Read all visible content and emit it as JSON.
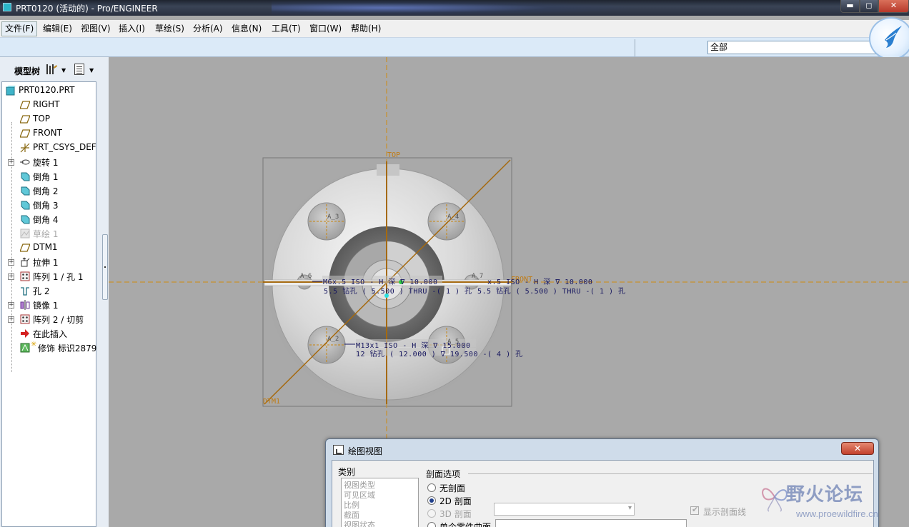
{
  "window": {
    "title": "PRT0120 (活动的) - Pro/ENGINEER",
    "min_glyph": "▬",
    "max_glyph": "◻",
    "close_glyph": "✕"
  },
  "menu": [
    {
      "label": "文件(F)",
      "active": true
    },
    {
      "label": "编辑(E)"
    },
    {
      "label": "视图(V)"
    },
    {
      "label": "插入(I)"
    },
    {
      "label": "草绘(S)"
    },
    {
      "label": "分析(A)"
    },
    {
      "label": "信息(N)"
    },
    {
      "label": "工具(T)"
    },
    {
      "label": "窗口(W)"
    },
    {
      "label": "帮助(H)"
    }
  ],
  "toolbar": {
    "filter_value": "全部"
  },
  "model_tree": {
    "title": "模型树",
    "items": [
      {
        "label": "PRT0120.PRT",
        "icon": "part-icon"
      },
      {
        "label": "RIGHT",
        "icon": "datum-plane-icon"
      },
      {
        "label": "TOP",
        "icon": "datum-plane-icon"
      },
      {
        "label": "FRONT",
        "icon": "datum-plane-icon"
      },
      {
        "label": "PRT_CSYS_DEF",
        "icon": "csys-icon"
      },
      {
        "label": "旋转 1",
        "icon": "revolve-icon",
        "expandable": true
      },
      {
        "label": "倒角 1",
        "icon": "chamfer-icon"
      },
      {
        "label": "倒角 2",
        "icon": "chamfer-icon"
      },
      {
        "label": "倒角 3",
        "icon": "chamfer-icon"
      },
      {
        "label": "倒角 4",
        "icon": "chamfer-icon"
      },
      {
        "label": "草绘 1",
        "icon": "sketch-icon",
        "disabled": true
      },
      {
        "label": "DTM1",
        "icon": "datum-plane-icon"
      },
      {
        "label": "拉伸 1",
        "icon": "extrude-icon",
        "expandable": true
      },
      {
        "label": "阵列 1 / 孔 1",
        "icon": "pattern-icon",
        "expandable": true
      },
      {
        "label": "孔 2",
        "icon": "hole-icon"
      },
      {
        "label": "镜像 1",
        "icon": "mirror-icon",
        "expandable": true
      },
      {
        "label": "阵列 2 / 切剪",
        "icon": "pattern-icon",
        "expandable": true
      },
      {
        "label": "在此插入",
        "icon": "insert-here-icon"
      },
      {
        "label": "修饰 标识2879",
        "icon": "cosmetic-icon"
      }
    ]
  },
  "viewport": {
    "axis_top": "TOP",
    "axis_front": "FRONT",
    "axis_dtm": "DTM1",
    "axes": [
      "A_3",
      "A_4",
      "A_6",
      "A_7",
      "A_2",
      "A_5"
    ],
    "annotations": {
      "thread_left_l1": "M6x.5 ISO - H 深 ∇ 10.000",
      "thread_right_l1": "x.5 ISO - H 深 ∇ 10.000",
      "thread_left_l2": "5.5 钻孔 ( 5.500 )  THRU  -( 1 ) 孔",
      "thread_right_l2": "5.5 钻孔 ( 5.500 )  THRU  -( 1 ) 孔",
      "thread_bot_l1": "M13x1 ISO - H 深 ∇ 15.000",
      "thread_bot_l2": "12 钻孔 ( 12.000 ) ∇ 19.500  -( 4 ) 孔"
    },
    "colors": {
      "datum": "#c8860f",
      "dimension": "#15155e",
      "background": "#a9a9a9"
    }
  },
  "dialog": {
    "title": "绘图视图",
    "close_label": "✕",
    "category_label": "类别",
    "categories": [
      "视图类型",
      "可见区域",
      "比例",
      "截面",
      "视图状态"
    ],
    "section_title": "剖面选项",
    "options": [
      {
        "label": "无剖面",
        "checked": false,
        "disabled": false
      },
      {
        "label": "2D 剖面",
        "checked": true,
        "disabled": false
      },
      {
        "label": "3D 剖面",
        "checked": false,
        "disabled": true
      },
      {
        "label": "单个零件曲面",
        "checked": false,
        "disabled": false
      }
    ],
    "show_hatch_label": "显示剖面线"
  },
  "watermark": {
    "name": "野火论坛",
    "url": "www.proewildfire.cn"
  }
}
